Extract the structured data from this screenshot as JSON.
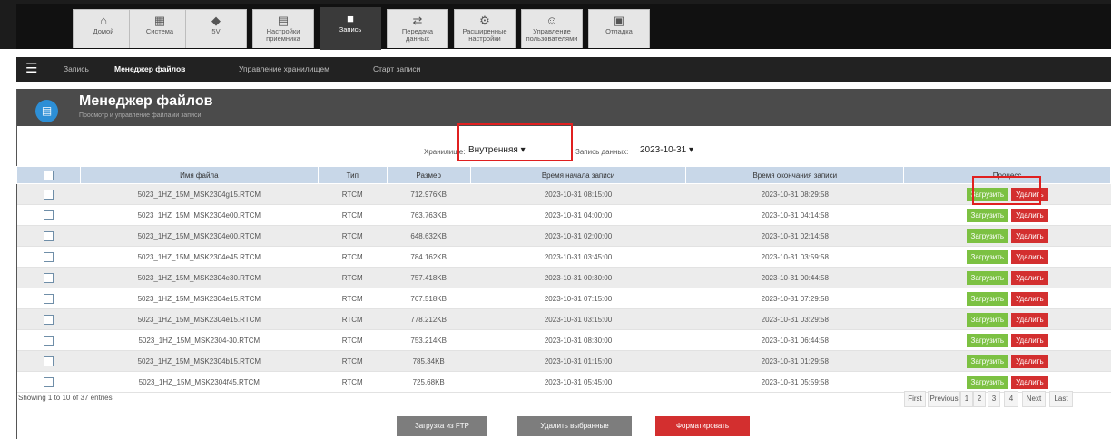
{
  "top_tabs": [
    {
      "label": "Домой",
      "icon": "home-icon",
      "glyph": "⌂"
    },
    {
      "label": "Система",
      "icon": "system-icon",
      "glyph": "▦"
    },
    {
      "label": "5V",
      "icon": "power-icon",
      "glyph": "◆"
    },
    {
      "label": "Настройки приемника",
      "icon": "receiver-icon",
      "glyph": "▤"
    },
    {
      "label": "Запись",
      "icon": "record-icon",
      "glyph": "■"
    },
    {
      "label": "Передача данных",
      "icon": "transfer-icon",
      "glyph": "⇄"
    },
    {
      "label": "Расширенные настройки",
      "icon": "gear-icon",
      "glyph": "⚙"
    },
    {
      "label": "Управление пользователями",
      "icon": "user-icon",
      "glyph": "☺"
    },
    {
      "label": "Отладка",
      "icon": "debug-icon",
      "glyph": "▣"
    }
  ],
  "active_tab": 4,
  "subnav": {
    "items": [
      "Запись",
      "Менеджер файлов",
      "Управление хранилищем",
      "Старт записи"
    ],
    "active": 1
  },
  "panel": {
    "title": "Менеджер файлов",
    "subtitle": "Просмотр и управление файлами записи"
  },
  "filters": {
    "storage_label": "Хранилище:",
    "storage_value": "Внутренняя",
    "date_label": "Запись данных:",
    "date_value": "2023-10-31"
  },
  "table": {
    "columns": [
      "",
      "Имя файла",
      "Тип",
      "Размер",
      "Время начала записи",
      "Время окончания записи",
      "Процесс"
    ],
    "download_label": "Загрузить",
    "delete_label": "Удалить",
    "rows": [
      {
        "name": "5023_1HZ_15M_MSK2304g15.RTCM",
        "type": "RTCM",
        "size": "712.976KB",
        "start": "2023-10-31 08:15:00",
        "end": "2023-10-31 08:29:58"
      },
      {
        "name": "5023_1HZ_15M_MSK2304e00.RTCM",
        "type": "RTCM",
        "size": "763.763KB",
        "start": "2023-10-31 04:00:00",
        "end": "2023-10-31 04:14:58"
      },
      {
        "name": "5023_1HZ_15M_MSK2304e00.RTCM",
        "type": "RTCM",
        "size": "648.632KB",
        "start": "2023-10-31 02:00:00",
        "end": "2023-10-31 02:14:58"
      },
      {
        "name": "5023_1HZ_15M_MSK2304e45.RTCM",
        "type": "RTCM",
        "size": "784.162KB",
        "start": "2023-10-31 03:45:00",
        "end": "2023-10-31 03:59:58"
      },
      {
        "name": "5023_1HZ_15M_MSK2304e30.RTCM",
        "type": "RTCM",
        "size": "757.418KB",
        "start": "2023-10-31 00:30:00",
        "end": "2023-10-31 00:44:58"
      },
      {
        "name": "5023_1HZ_15M_MSK2304e15.RTCM",
        "type": "RTCM",
        "size": "767.518KB",
        "start": "2023-10-31 07:15:00",
        "end": "2023-10-31 07:29:58"
      },
      {
        "name": "5023_1HZ_15M_MSK2304e15.RTCM",
        "type": "RTCM",
        "size": "778.212KB",
        "start": "2023-10-31 03:15:00",
        "end": "2023-10-31 03:29:58"
      },
      {
        "name": "5023_1HZ_15M_MSK2304-30.RTCM",
        "type": "RTCM",
        "size": "753.214KB",
        "start": "2023-10-31 08:30:00",
        "end": "2023-10-31 06:44:58"
      },
      {
        "name": "5023_1HZ_15M_MSK2304b15.RTCM",
        "type": "RTCM",
        "size": "785.34KB",
        "start": "2023-10-31 01:15:00",
        "end": "2023-10-31 01:29:58"
      },
      {
        "name": "5023_1HZ_15M_MSK2304f45.RTCM",
        "type": "RTCM",
        "size": "725.68KB",
        "start": "2023-10-31 05:45:00",
        "end": "2023-10-31 05:59:58"
      }
    ]
  },
  "footer": {
    "info": "Showing 1 to 10 of 37 entries",
    "pagination": [
      "First",
      "Previous",
      "1",
      "2",
      "3",
      "4",
      "Next",
      "Last"
    ],
    "buttons": {
      "ftp": "Загрузка из FTP",
      "delete_selected": "Удалить выбранные",
      "format": "Форматировать"
    }
  },
  "colors": {
    "download": "#7cc142",
    "delete": "#d32f2f",
    "highlight": "#e02020",
    "header_row": "#c8d7e8"
  }
}
